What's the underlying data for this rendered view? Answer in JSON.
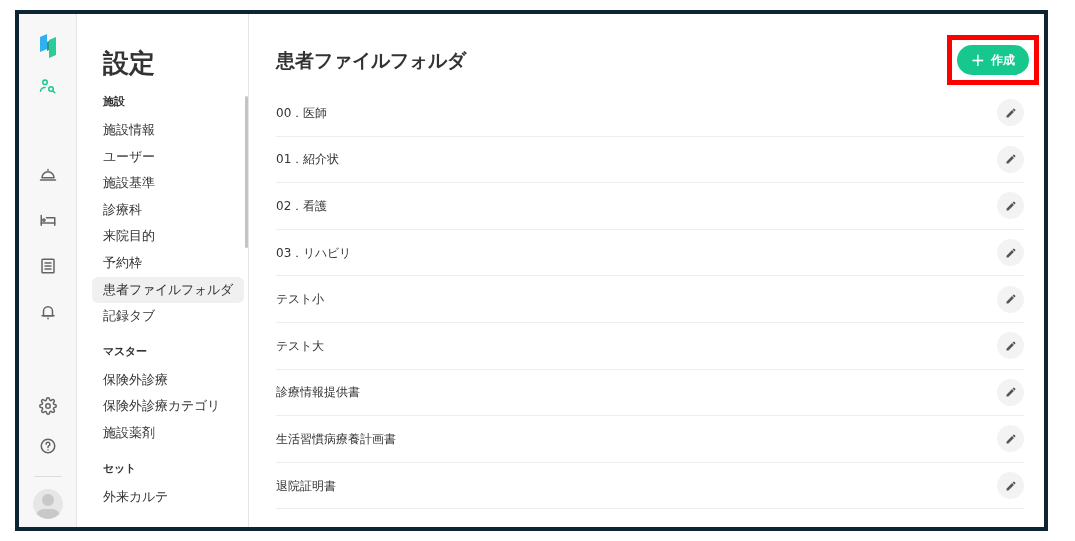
{
  "rail": [
    {
      "selected": false
    },
    {
      "selected": true
    },
    {
      "selected": false
    },
    {
      "selected": false
    },
    {
      "selected": false
    },
    {
      "selected": false
    },
    {
      "selected": false
    },
    {
      "selected": false
    }
  ],
  "settings_nav": {
    "title": "設定",
    "sections": [
      {
        "heading": "施設",
        "items": [
          {
            "label": "施設情報",
            "selected": false
          },
          {
            "label": "ユーザー",
            "selected": false
          },
          {
            "label": "施設基準",
            "selected": false
          },
          {
            "label": "診療科",
            "selected": false
          },
          {
            "label": "来院目的",
            "selected": false
          },
          {
            "label": "予約枠",
            "selected": false
          },
          {
            "label": "患者ファイルフォルダ",
            "selected": true
          },
          {
            "label": "記録タブ",
            "selected": false
          }
        ]
      },
      {
        "heading": "マスター",
        "items": [
          {
            "label": "保険外診療",
            "selected": false
          },
          {
            "label": "保険外診療カテゴリ",
            "selected": false
          },
          {
            "label": "施設薬剤",
            "selected": false
          }
        ]
      },
      {
        "heading": "セット",
        "items": [
          {
            "label": "外来カルテ",
            "selected": false
          }
        ]
      }
    ]
  },
  "page": {
    "title": "患者ファイルフォルダ",
    "create_button": {
      "icon": "+",
      "label": "作成",
      "highlighted": true
    }
  },
  "folders": [
    {
      "name": "00．医師"
    },
    {
      "name": "01．紹介状"
    },
    {
      "name": "02．看護"
    },
    {
      "name": "03．リハビリ"
    },
    {
      "name": "テスト小"
    },
    {
      "name": "テスト大"
    },
    {
      "name": "診療情報提供書"
    },
    {
      "name": "生活習慣病療養計画書"
    },
    {
      "name": "退院証明書"
    }
  ]
}
